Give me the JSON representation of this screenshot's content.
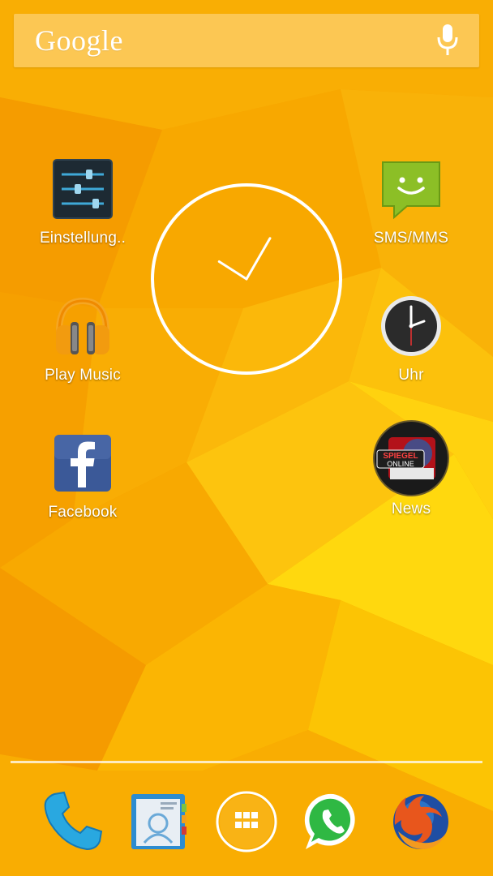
{
  "search": {
    "logo_text": "Google",
    "mic_icon": "microphone-icon"
  },
  "apps": [
    {
      "label": "Einstellung..",
      "icon": "settings-sliders-icon"
    },
    {
      "label": "Play Music",
      "icon": "headphones-icon"
    },
    {
      "label": "Facebook",
      "icon": "facebook-icon"
    },
    {
      "label": "SMS/MMS",
      "icon": "smiley-message-icon"
    },
    {
      "label": "Uhr",
      "icon": "clock-icon"
    },
    {
      "label": "News",
      "icon": "spiegel-online-icon",
      "logo_text": [
        "SPIEGEL",
        "ONLINE"
      ]
    }
  ],
  "clock_widget": {
    "time": "10:05"
  },
  "dock": [
    {
      "icon": "phone-icon"
    },
    {
      "icon": "contacts-icon"
    },
    {
      "icon": "app-drawer-icon"
    },
    {
      "icon": "whatsapp-icon"
    },
    {
      "icon": "firefox-icon"
    }
  ],
  "colors": {
    "wallpaper": "#f8a800",
    "accent_light": "#ffd400",
    "text": "#ffffff"
  }
}
